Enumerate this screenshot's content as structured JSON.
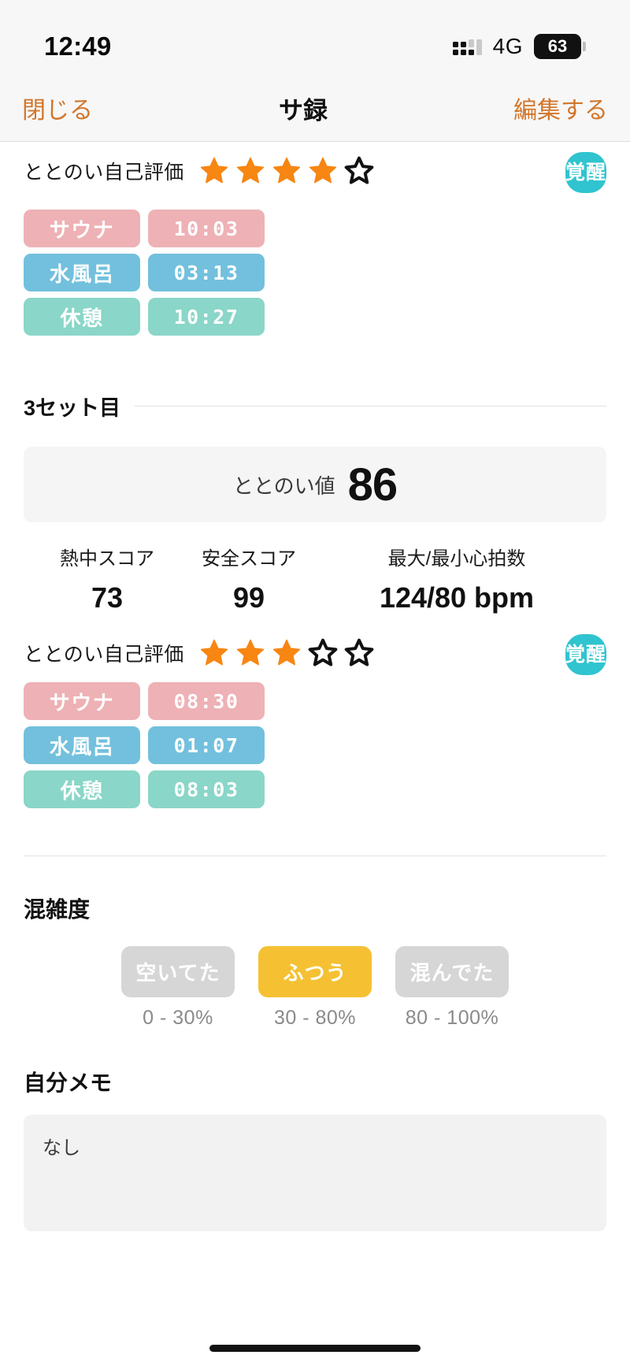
{
  "status_bar": {
    "time": "12:49",
    "network": "4G",
    "battery_percent": "63",
    "signal_icon": "signal-dots-icon",
    "battery_icon": "battery-icon"
  },
  "nav_bar": {
    "close_label": "閉じる",
    "title": "サ録",
    "edit_label": "編集する"
  },
  "colors": {
    "accent_orange": "#d2762a",
    "star_filled": "#f78612",
    "badge_teal": "#2fc4cf",
    "sauna_pink": "#eeb1b5",
    "water_blue": "#72c0dd",
    "rest_green": "#8ad6c8",
    "crowd_selected": "#f5c133",
    "crowd_unselected": "#d6d6d6"
  },
  "previous_set": {
    "rating": {
      "label": "ととのい自己評価",
      "filled": 4,
      "total": 5
    },
    "state_badge": "覚醒",
    "chips": [
      {
        "name": "サウナ",
        "time": "10:03",
        "color_key": "c-sauna"
      },
      {
        "name": "水風呂",
        "time": "03:13",
        "color_key": "c-water"
      },
      {
        "name": "休憩",
        "time": "10:27",
        "color_key": "c-rest"
      }
    ]
  },
  "set3": {
    "header": "3セット目",
    "score_card": {
      "label": "ととのい値",
      "value": "86"
    },
    "metrics": [
      {
        "label": "熱中スコア",
        "value": "73"
      },
      {
        "label": "安全スコア",
        "value": "99"
      },
      {
        "label": "最大/最小心拍数",
        "value": "124/80 bpm"
      }
    ],
    "rating": {
      "label": "ととのい自己評価",
      "filled": 3,
      "total": 5
    },
    "state_badge": "覚醒",
    "chips": [
      {
        "name": "サウナ",
        "time": "08:30",
        "color_key": "c-sauna"
      },
      {
        "name": "水風呂",
        "time": "01:07",
        "color_key": "c-water"
      },
      {
        "name": "休憩",
        "time": "08:03",
        "color_key": "c-rest"
      }
    ]
  },
  "crowding": {
    "title": "混雑度",
    "options": [
      {
        "label": "空いてた",
        "range": "0 - 30%",
        "selected": false
      },
      {
        "label": "ふつう",
        "range": "30 - 80%",
        "selected": true
      },
      {
        "label": "混んでた",
        "range": "80 - 100%",
        "selected": false
      }
    ]
  },
  "memo": {
    "title": "自分メモ",
    "value": "なし"
  }
}
